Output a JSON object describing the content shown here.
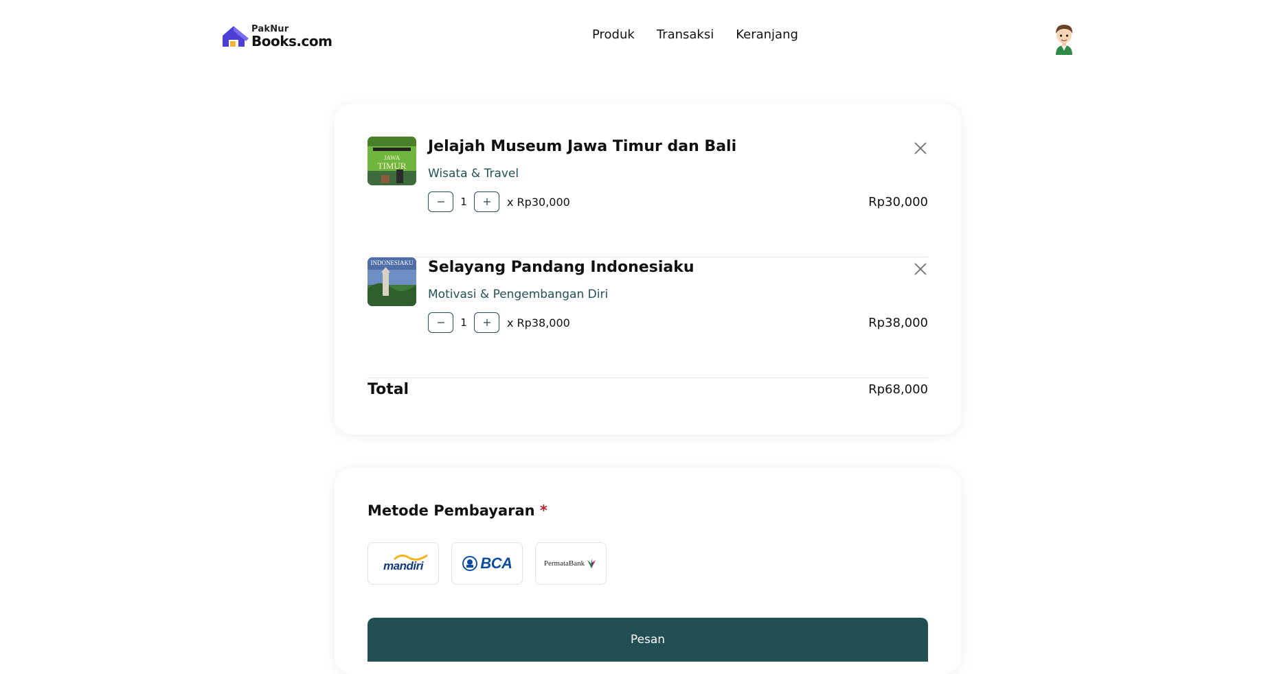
{
  "brand": {
    "line1": "PakNur",
    "line2": "Books.com"
  },
  "nav": {
    "items": [
      "Produk",
      "Transaksi",
      "Keranjang"
    ]
  },
  "cart": {
    "items": [
      {
        "title": "Jelajah Museum Jawa Timur dan Bali",
        "category": "Wisata & Travel",
        "qty": "1",
        "unit_price": "x Rp30,000",
        "line_total": "Rp30,000",
        "cover_text": [
          "JAWA",
          "TIMUR"
        ]
      },
      {
        "title": "Selayang Pandang Indonesiaku",
        "category": "Motivasi & Pengembangan Diri",
        "qty": "1",
        "unit_price": "x Rp38,000",
        "line_total": "Rp38,000",
        "cover_text": [
          "INDONESIAKU"
        ]
      }
    ],
    "total_label": "Total",
    "total_value": "Rp68,000"
  },
  "payment": {
    "title": "Metode Pembayaran",
    "required_mark": "*",
    "banks": [
      {
        "name": "mandiri",
        "logo_text": "mandiri"
      },
      {
        "name": "BCA",
        "logo_text": "BCA"
      },
      {
        "name": "PermataBank",
        "logo_text": "PermataBank"
      }
    ],
    "submit_label": "Pesan"
  },
  "colors": {
    "primary": "#224f54",
    "category_text": "#225157",
    "required": "#b4232f",
    "logo_purple": "#4b3fd6"
  }
}
